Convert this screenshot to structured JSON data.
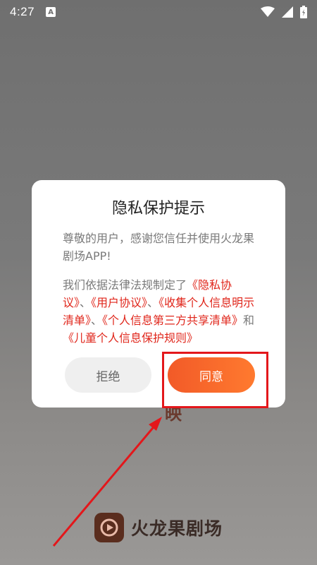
{
  "status_bar": {
    "time": "4:27",
    "notification_letter": "A"
  },
  "background": {
    "hidden_glyph": "映",
    "app_name": "火龙果剧场"
  },
  "dialog": {
    "title": "隐私保护提示",
    "paragraph1": "尊敬的用户，感谢您信任并使用火龙果剧场APP!",
    "paragraph2_intro": "我们依据法律法规制定了",
    "links": [
      "《隐私协议》",
      "《用户协议》",
      "《收集个人信息明示清单》",
      "《个人信息第三方共享清单》",
      "《儿童个人信息保护规则》"
    ],
    "separators": [
      "、",
      "、",
      "、",
      "和"
    ],
    "decline_label": "拒绝",
    "agree_label": "同意"
  },
  "colors": {
    "accent_gradient_start": "#f25a28",
    "accent_gradient_end": "#ff7a2f",
    "link": "#e0261b",
    "annotation": "#e3171b"
  }
}
